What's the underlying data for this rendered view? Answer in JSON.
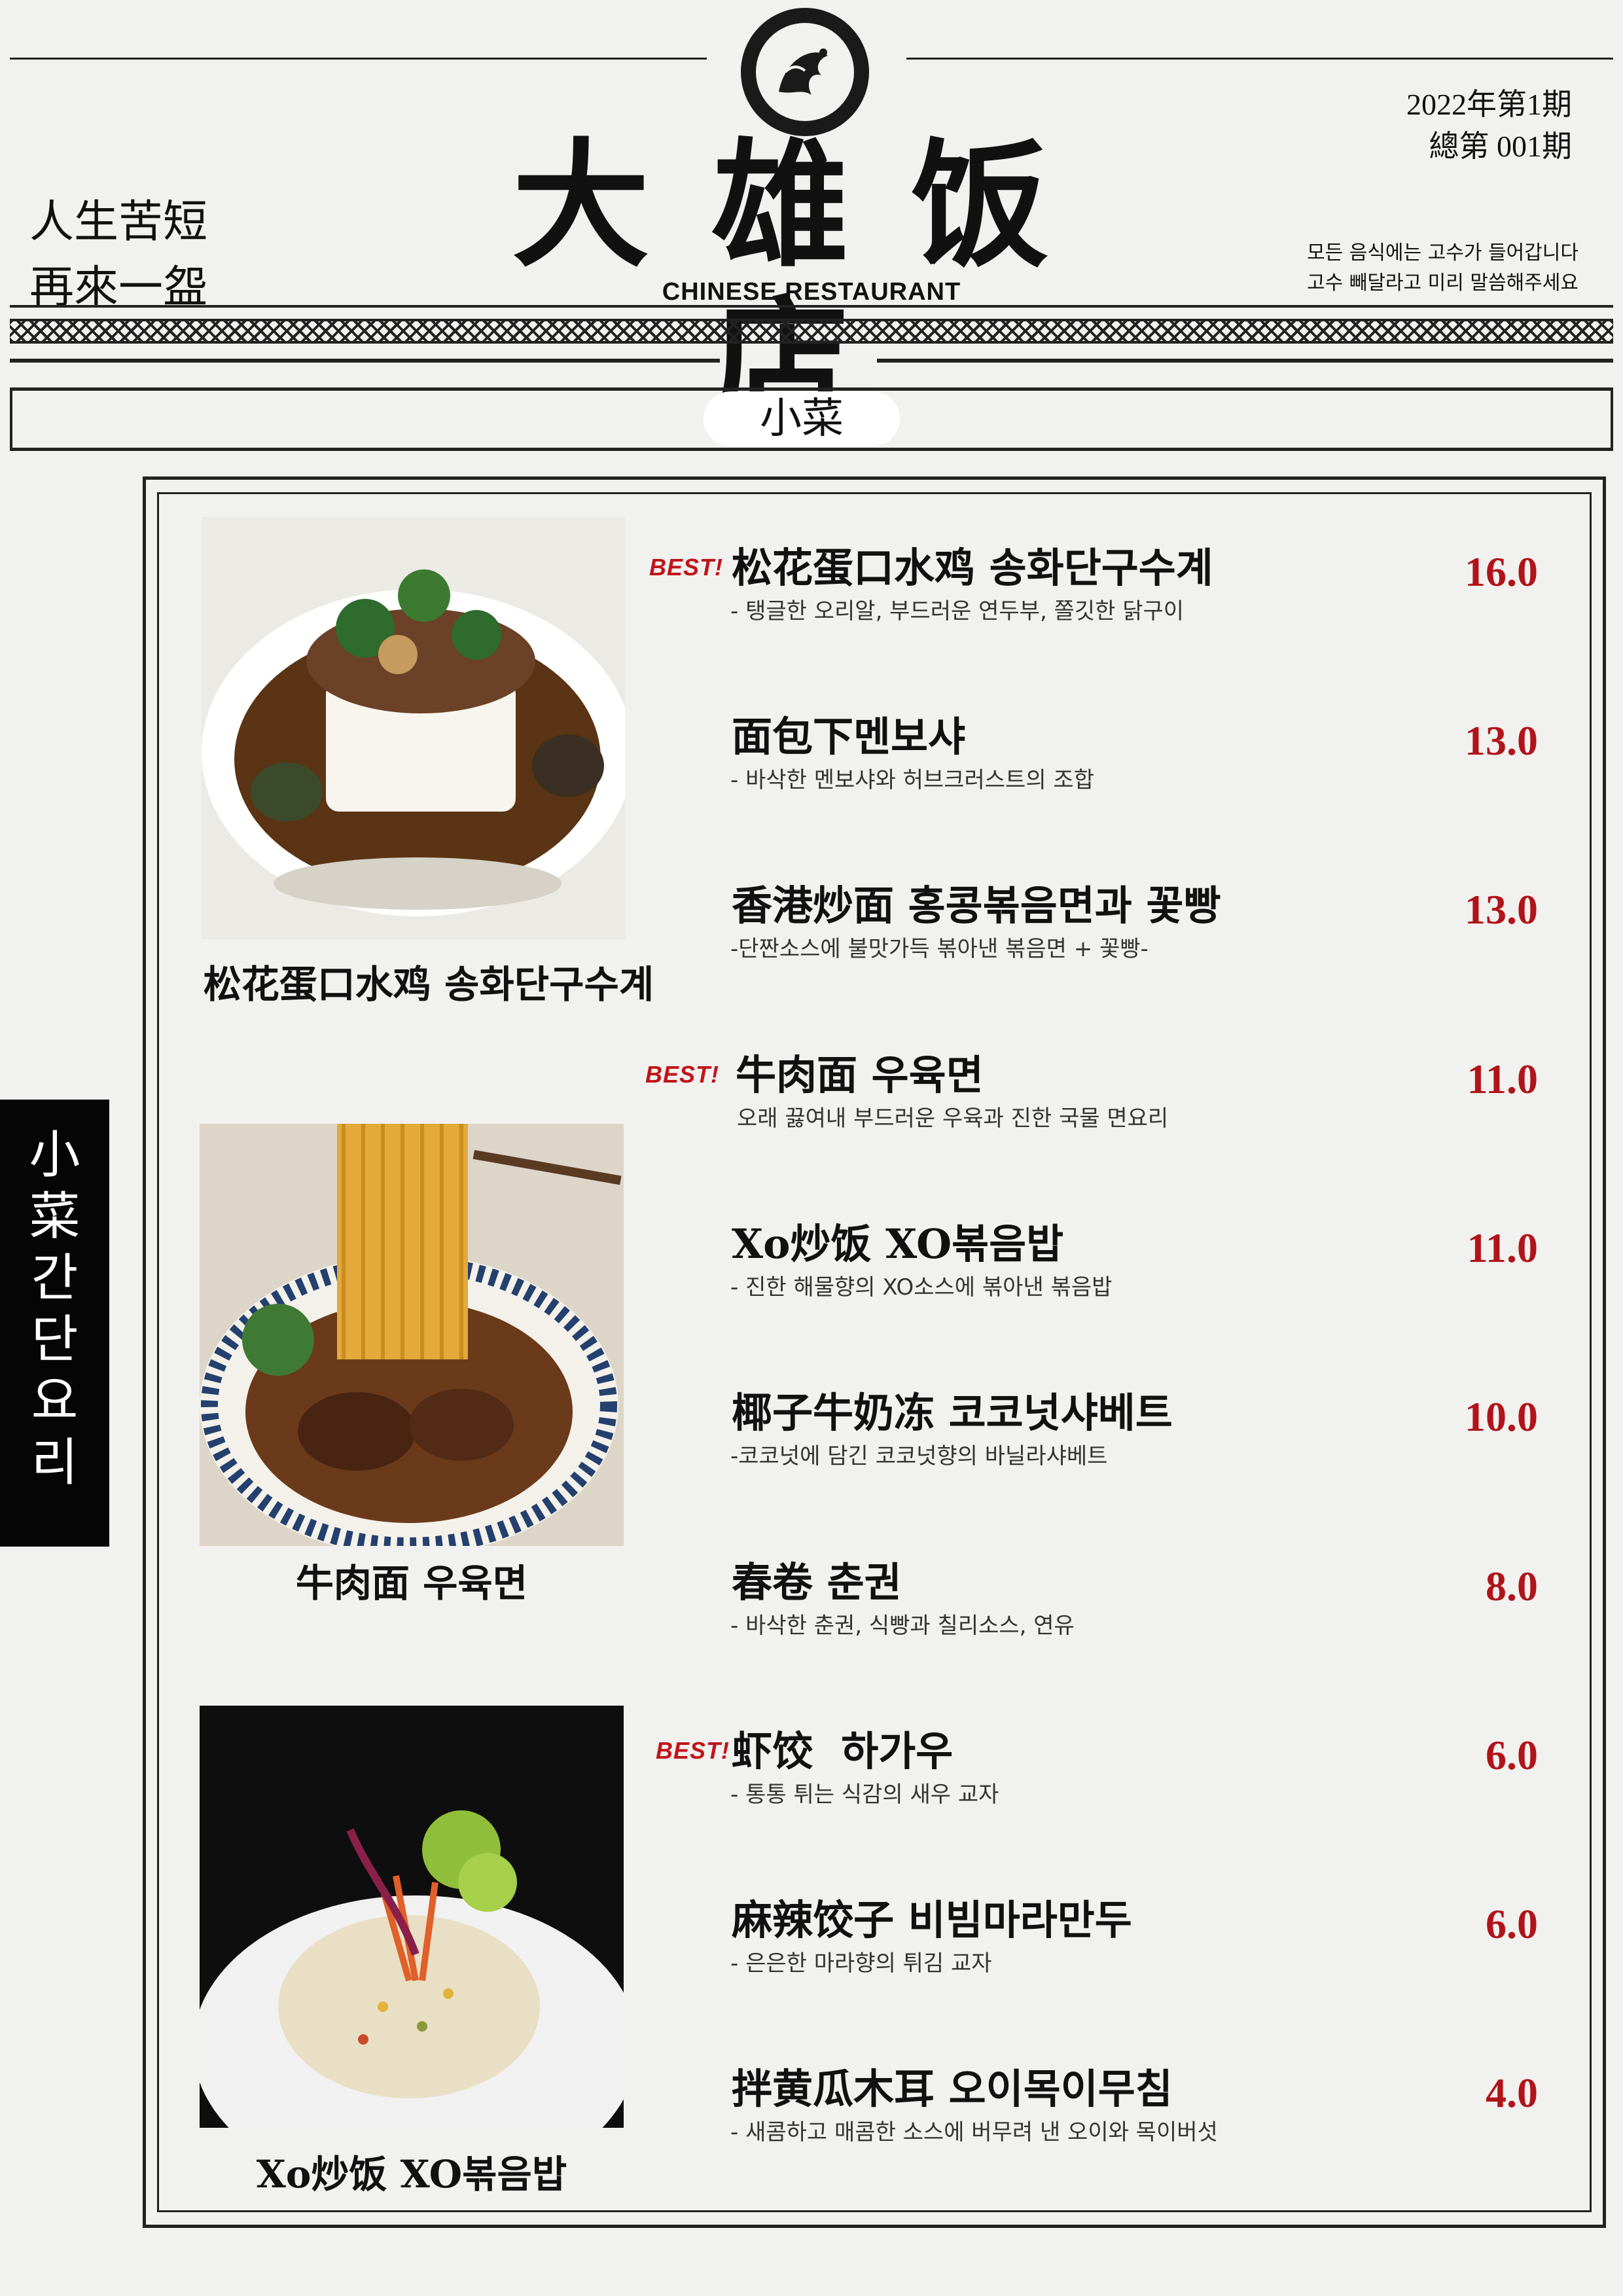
{
  "header": {
    "brand_name": "大雄饭店",
    "brand_subtitle": "CHINESE RESTAURANT",
    "slogan_line1": "人生苦短",
    "slogan_line2": "再來一盌",
    "issue_line1": "2022年第1期",
    "issue_line2": "總第 001期",
    "notice_line1": "모든 음식에는 고수가 들어갑니다",
    "notice_line2": "고수 빼달라고 미리 말씀해주세요"
  },
  "section": {
    "title": "小菜",
    "side_label": [
      "小",
      "菜",
      "간",
      "단",
      "요",
      "리"
    ]
  },
  "photos": [
    {
      "caption_cn": "松花蛋口水鸡",
      "caption_kr": "송화단구수계"
    },
    {
      "caption_cn": "牛肉面",
      "caption_kr": "우육면"
    },
    {
      "caption_cn": "Xo炒饭",
      "caption_kr": "XO볶음밥"
    }
  ],
  "best_label": "BEST!",
  "menu": [
    {
      "name_cn": "松花蛋口水鸡",
      "name_kr": "송화단구수계",
      "desc": "- 탱글한 오리알, 부드러운 연두부, 쫄깃한 닭구이",
      "price": "16.0",
      "best": true
    },
    {
      "name_cn": "面包下",
      "name_kr": "멘보샤",
      "desc": "- 바삭한 멘보샤와 허브크러스트의 조합",
      "price": "13.0",
      "best": false
    },
    {
      "name_cn": "香港炒面",
      "name_kr": "홍콩볶음면과 꽃빵",
      "desc": "-단짠소스에 불맛가득 볶아낸 볶음면 + 꽃빵-",
      "price": "13.0",
      "best": false
    },
    {
      "name_cn": "牛肉面",
      "name_kr": "우육면",
      "desc": "오래 끓여내 부드러운 우육과 진한 국물 면요리",
      "price": "11.0",
      "best": true
    },
    {
      "name_cn": "Xo炒饭",
      "name_kr": "XO볶음밥",
      "desc": "- 진한 해물향의 XO소스에 볶아낸 볶음밥",
      "price": "11.0",
      "best": false
    },
    {
      "name_cn": "椰子牛奶冻",
      "name_kr": "코코넛샤베트",
      "desc": "-코코넛에 담긴 코코넛향의 바닐라샤베트",
      "price": "10.0",
      "best": false
    },
    {
      "name_cn": "春卷",
      "name_kr": "춘권",
      "desc": "- 바삭한 춘권, 식빵과 칠리소스, 연유",
      "price": "8.0",
      "best": false
    },
    {
      "name_cn": "虾饺",
      "name_kr": "하가우",
      "desc": "- 통통 튀는 식감의 새우 교자",
      "price": "6.0",
      "best": true
    },
    {
      "name_cn": "麻辣饺子",
      "name_kr": "비빔마라만두",
      "desc": "- 은은한 마라향의 튀김 교자",
      "price": "6.0",
      "best": false
    },
    {
      "name_cn": "拌黄瓜木耳",
      "name_kr": "오이목이무침",
      "desc": "- 새콤하고 매콤한 소스에 버무려 낸 오이와 목이버섯",
      "price": "4.0",
      "best": false
    }
  ]
}
